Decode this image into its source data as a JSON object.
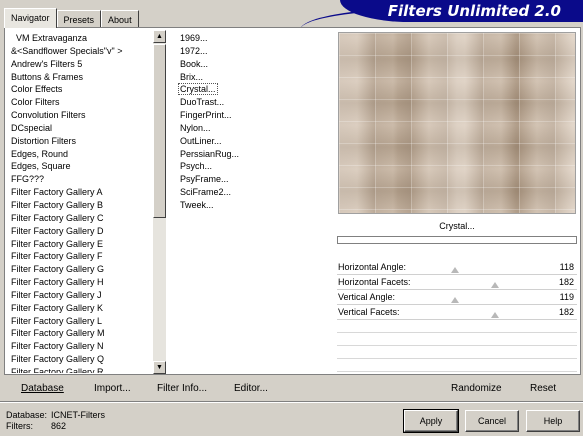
{
  "tabs": [
    "Navigator",
    "Presets",
    "About"
  ],
  "banner_title": "Filters Unlimited 2.0",
  "categories": [
    "VM Extravaganza",
    "&<Sandflower Specials\"v\" >",
    "Andrew's Filters 5",
    "Buttons & Frames",
    "Color Effects",
    "Color Filters",
    "Convolution Filters",
    "DCspecial",
    "Distortion Filters",
    "Edges, Round",
    "Edges, Square",
    "FFG???",
    "Filter Factory Gallery A",
    "Filter Factory Gallery B",
    "Filter Factory Gallery C",
    "Filter Factory Gallery D",
    "Filter Factory Gallery E",
    "Filter Factory Gallery F",
    "Filter Factory Gallery G",
    "Filter Factory Gallery H",
    "Filter Factory Gallery J",
    "Filter Factory Gallery K",
    "Filter Factory Gallery L",
    "Filter Factory Gallery M",
    "Filter Factory Gallery N",
    "Filter Factory Gallery Q",
    "Filter Factory Gallery R"
  ],
  "filters": [
    "1969...",
    "1972...",
    "Book...",
    "Brix...",
    "Crystal...",
    "DuoTrast...",
    "FingerPrint...",
    "Nylon...",
    "OutLiner...",
    "PerssianRug...",
    "Psych...",
    "PsyFrame...",
    "SciFrame2...",
    "Tweek..."
  ],
  "selected_filter": "Crystal...",
  "sliders": [
    {
      "label": "Horizontal Angle:",
      "value": "118",
      "level": 0.46
    },
    {
      "label": "Horizontal Facets:",
      "value": "182",
      "level": 0.71
    },
    {
      "label": "Vertical Angle:",
      "value": "119",
      "level": 0.46
    },
    {
      "label": "Vertical Facets:",
      "value": "182",
      "level": 0.71
    }
  ],
  "bottom_buttons": {
    "database": "Database",
    "import": "Import...",
    "filter_info": "Filter Info...",
    "editor": "Editor...",
    "randomize": "Randomize",
    "reset": "Reset"
  },
  "status": {
    "database_label": "Database:",
    "database_value": "ICNET-Filters",
    "filters_label": "Filters:",
    "filters_value": "862"
  },
  "dialog_buttons": {
    "apply": "Apply",
    "cancel": "Cancel",
    "help": "Help"
  },
  "icons": {
    "scroll_up": "▲",
    "scroll_down": "▼"
  }
}
